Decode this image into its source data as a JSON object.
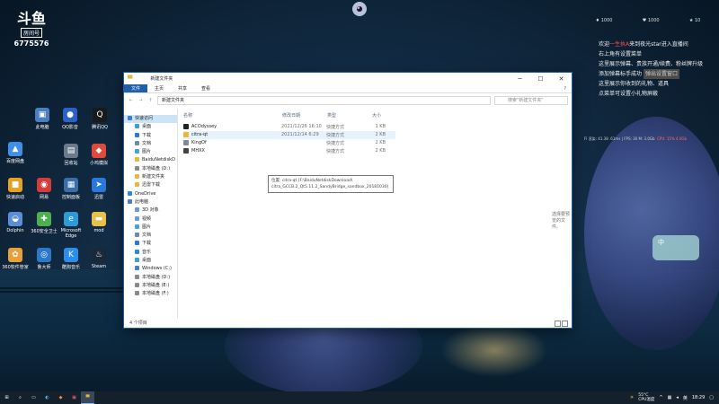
{
  "stream": {
    "logo_text": "斗鱼",
    "logo_sub": "房间号",
    "room_id": "6775576"
  },
  "top_stats": [
    "1000",
    "1000",
    "10"
  ],
  "chat": {
    "line1_prefix": "欢迎",
    "line1_user": "一生执A",
    "line1_suffix": "来到夜光star进入直播间",
    "line2": "右上角有设置菜单",
    "line3": "这里展示弹幕、贵族开通/续费、粉丝牌升级",
    "line4": "添加弹幕标手成功",
    "tag": "弹出设置窗口",
    "line5": "这里展示你收到的礼物、道具",
    "line6": "点菜单可设置小礼物屏蔽"
  },
  "perf": {
    "left": "Fl 渲染: 41.38 .61ms | FPS: 30 M: 3.0Gb",
    "right": "CPU: 15% 4.0Gb"
  },
  "float_widget": "中",
  "desktop_icons": [
    {
      "label": "此电脑",
      "color": "#4a7ebf",
      "glyph": "▣"
    },
    {
      "label": "QQ影音",
      "color": "#2a63c8",
      "glyph": "●"
    },
    {
      "label": "腾讯QQ",
      "color": "#1a1a1a",
      "glyph": "Q"
    },
    {
      "label": "百度网盘",
      "color": "#3f8fe8",
      "glyph": "▲"
    },
    {
      "label": "回收站",
      "color": "#6a7a8a",
      "glyph": "▤"
    },
    {
      "label": "小鸡模拟",
      "color": "#e04a3a",
      "glyph": "◆"
    },
    {
      "label": "快速启动",
      "color": "#e6a321",
      "glyph": "■"
    },
    {
      "label": "网易",
      "color": "#d43c3c",
      "glyph": "◉"
    },
    {
      "label": "控制面板",
      "color": "#3a6ea8",
      "glyph": "▦"
    },
    {
      "label": "迅雷",
      "color": "#2a78d8",
      "glyph": "➤"
    },
    {
      "label": "Dolphin",
      "color": "#5a8ed8",
      "glyph": "◒"
    },
    {
      "label": "360安全卫士",
      "color": "#4caf50",
      "glyph": "✚"
    },
    {
      "label": "Microsoft Edge",
      "color": "#2c9bd8",
      "glyph": "e"
    },
    {
      "label": "mod",
      "color": "#e8c14a",
      "glyph": "▬"
    },
    {
      "label": "360软件管家",
      "color": "#e8a13a",
      "glyph": "✿"
    },
    {
      "label": "鲁大师",
      "color": "#2c78c8",
      "glyph": "◎"
    },
    {
      "label": "酷狗音乐",
      "color": "#2c8ee8",
      "glyph": "K"
    },
    {
      "label": "Steam",
      "color": "#1b2838",
      "glyph": "♨"
    }
  ],
  "window": {
    "title": "新建文件夹",
    "ribbon_tabs": [
      "文件",
      "主页",
      "共享",
      "查看"
    ],
    "nav_back": "←",
    "nav_forward": "→",
    "nav_up": "↑",
    "breadcrumb": "新建文件夹",
    "search_placeholder": "搜索\"新建文件夹\"",
    "nav_items": [
      "快速访问",
      "桌面",
      "下载",
      "文档",
      "图片",
      "BaiduNetdiskD",
      "本地磁盘 (D:)",
      "新建文件夹",
      "迅雷下载",
      "OneDrive",
      "此电脑",
      "3D 对象",
      "视频",
      "图片",
      "文档",
      "下载",
      "音乐",
      "桌面",
      "Windows (C:)",
      "本地磁盘 (D:)",
      "本地磁盘 (E:)",
      "本地磁盘 (F:)"
    ],
    "columns": {
      "name": "名称",
      "date": "修改日期",
      "type": "类型",
      "size": "大小"
    },
    "files": [
      {
        "name": "ACOdyssey",
        "date": "2021/12/26 16:10",
        "type": "快捷方式",
        "size": "1 KB",
        "icon_color": "#222222"
      },
      {
        "name": "citra-qt",
        "date": "2021/12/14 6:29",
        "type": "快捷方式",
        "size": "2 KB",
        "icon_color": "#e8b83a"
      },
      {
        "name": "KingOf",
        "date": "",
        "type": "快捷方式",
        "size": "2 KB",
        "icon_color": "#7a8aa0"
      },
      {
        "name": "MHXX",
        "date": "",
        "type": "快捷方式",
        "size": "2 KB",
        "icon_color": "#444444"
      }
    ],
    "tooltip_line1": "位置: citra-qt (F:\\BaiduNetdiskDownload\\",
    "tooltip_line2": "citra_GCCB.2_Qt5.11.2_SandyBridge_sandbox_20181030)",
    "preview_message": "选择要预览的文件。",
    "status": "4 个项目"
  },
  "taskbar": {
    "start_icon": "⊞",
    "weather_temp": "55°C",
    "weather_label": "CPU温度",
    "time": "18:29",
    "lang": "英"
  },
  "colors": {
    "accent": "#1e5fa8",
    "hover": "#e5f3ff",
    "selected": "#cce4f7",
    "taskbar": "#14202c"
  }
}
